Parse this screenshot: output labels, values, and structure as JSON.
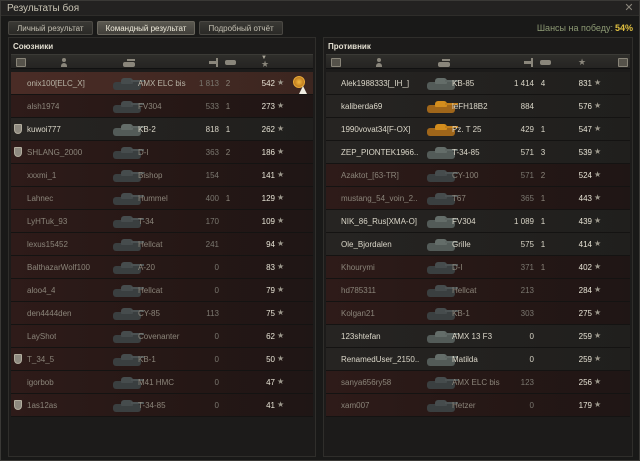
{
  "window": {
    "title": "Результаты боя",
    "close_icon": "close-icon"
  },
  "tabs": [
    {
      "label": "Личный результат",
      "active": false
    },
    {
      "label": "Командный результат",
      "active": true
    },
    {
      "label": "Подробный отчёт",
      "active": false
    }
  ],
  "win_chance": {
    "label": "Шансы на победу:",
    "value": "54%"
  },
  "colors": {
    "accent": "#e0c040",
    "alive_text": "#dcd8ca",
    "dead_text": "#8b857a",
    "dead_row": "#2e1b19",
    "premium_tank": "#d38d1d"
  },
  "allies": {
    "title": "Союзники",
    "columns": [
      "platoon-icon",
      "player-icon",
      "vehicle-icon",
      "damage-icon",
      "kills-icon",
      "experience-star-icon"
    ],
    "rows": [
      {
        "player": "onix100[ELC_X]",
        "vehicle": "AMX ELC bis",
        "damage": "1 813",
        "kills": "2",
        "xp": "542",
        "alive": false,
        "platoon": false,
        "highlight": true,
        "medal": true,
        "tank": "dark"
      },
      {
        "player": "alsh1974",
        "vehicle": "FV304",
        "damage": "533",
        "kills": "1",
        "xp": "273",
        "alive": false,
        "platoon": false,
        "highlight": false,
        "medal": false,
        "tank": "dark"
      },
      {
        "player": "kuwoi777",
        "vehicle": "KB-2",
        "damage": "818",
        "kills": "1",
        "xp": "262",
        "alive": true,
        "platoon": true,
        "highlight": false,
        "medal": false,
        "tank": "live"
      },
      {
        "player": "SHLANG_2000",
        "vehicle": "D-I",
        "damage": "363",
        "kills": "2",
        "xp": "186",
        "alive": false,
        "platoon": true,
        "highlight": false,
        "medal": false,
        "tank": "dark"
      },
      {
        "player": "xxxmi_1",
        "vehicle": "Bishop",
        "damage": "154",
        "kills": "",
        "xp": "141",
        "alive": false,
        "platoon": false,
        "highlight": false,
        "medal": false,
        "tank": "dark"
      },
      {
        "player": "Lahnec",
        "vehicle": "Hummel",
        "damage": "400",
        "kills": "1",
        "xp": "129",
        "alive": false,
        "platoon": false,
        "highlight": false,
        "medal": false,
        "tank": "dark"
      },
      {
        "player": "LyHTuk_93",
        "vehicle": "T-34",
        "damage": "170",
        "kills": "",
        "xp": "109",
        "alive": false,
        "platoon": false,
        "highlight": false,
        "medal": false,
        "tank": "dark"
      },
      {
        "player": "lexus15452",
        "vehicle": "Hellcat",
        "damage": "241",
        "kills": "",
        "xp": "94",
        "alive": false,
        "platoon": false,
        "highlight": false,
        "medal": false,
        "tank": "dark"
      },
      {
        "player": "BalthazarWolf100",
        "vehicle": "A-20",
        "damage": "0",
        "kills": "",
        "xp": "83",
        "alive": false,
        "platoon": false,
        "highlight": false,
        "medal": false,
        "tank": "dark"
      },
      {
        "player": "aloo4_4",
        "vehicle": "Hellcat",
        "damage": "0",
        "kills": "",
        "xp": "79",
        "alive": false,
        "platoon": false,
        "highlight": false,
        "medal": false,
        "tank": "dark"
      },
      {
        "player": "den4444den",
        "vehicle": "CY-85",
        "damage": "113",
        "kills": "",
        "xp": "75",
        "alive": false,
        "platoon": false,
        "highlight": false,
        "medal": false,
        "tank": "dark"
      },
      {
        "player": "LayShot",
        "vehicle": "Covenanter",
        "damage": "0",
        "kills": "",
        "xp": "62",
        "alive": false,
        "platoon": false,
        "highlight": false,
        "medal": false,
        "tank": "dark"
      },
      {
        "player": "T_34_5",
        "vehicle": "KB-1",
        "damage": "0",
        "kills": "",
        "xp": "50",
        "alive": false,
        "platoon": true,
        "highlight": false,
        "medal": false,
        "tank": "dark"
      },
      {
        "player": "igorbob",
        "vehicle": "M41 HMC",
        "damage": "0",
        "kills": "",
        "xp": "47",
        "alive": false,
        "platoon": false,
        "highlight": false,
        "medal": false,
        "tank": "dark"
      },
      {
        "player": "1as12as",
        "vehicle": "T-34-85",
        "damage": "0",
        "kills": "",
        "xp": "41",
        "alive": false,
        "platoon": true,
        "highlight": false,
        "medal": false,
        "tank": "dark"
      }
    ]
  },
  "enemies": {
    "title": "Противник",
    "rows": [
      {
        "player": "Alek1988333[_IH_]",
        "vehicle": "KB-85",
        "damage": "1 414",
        "kills": "4",
        "xp": "831",
        "alive": true,
        "platoon": false,
        "tank": "live"
      },
      {
        "player": "kaliberda69",
        "vehicle": "leFH18B2",
        "damage": "884",
        "kills": "",
        "xp": "576",
        "alive": true,
        "platoon": false,
        "tank": "gold"
      },
      {
        "player": "1990vovat34[F-OX]",
        "vehicle": "Pz. T 25",
        "damage": "429",
        "kills": "1",
        "xp": "547",
        "alive": true,
        "platoon": false,
        "tank": "gold"
      },
      {
        "player": "ZEP_PIONTEK1966..",
        "vehicle": "T-34-85",
        "damage": "571",
        "kills": "3",
        "xp": "539",
        "alive": true,
        "platoon": false,
        "tank": "live"
      },
      {
        "player": "Azaktot_[63-TR]",
        "vehicle": "CY-100",
        "damage": "571",
        "kills": "2",
        "xp": "524",
        "alive": false,
        "platoon": false,
        "tank": "dark"
      },
      {
        "player": "mustang_54_voin_2..",
        "vehicle": "T67",
        "damage": "365",
        "kills": "1",
        "xp": "443",
        "alive": false,
        "platoon": false,
        "tank": "dark"
      },
      {
        "player": "NIK_86_Rus[XMA-O]",
        "vehicle": "FV304",
        "damage": "1 089",
        "kills": "1",
        "xp": "439",
        "alive": true,
        "platoon": false,
        "tank": "live"
      },
      {
        "player": "Ole_Bjordalen",
        "vehicle": "Grille",
        "damage": "575",
        "kills": "1",
        "xp": "414",
        "alive": true,
        "platoon": false,
        "tank": "live"
      },
      {
        "player": "Khourymi",
        "vehicle": "D-I",
        "damage": "371",
        "kills": "1",
        "xp": "402",
        "alive": false,
        "platoon": false,
        "tank": "dark"
      },
      {
        "player": "hd785311",
        "vehicle": "Hellcat",
        "damage": "213",
        "kills": "",
        "xp": "284",
        "alive": false,
        "platoon": false,
        "tank": "dark"
      },
      {
        "player": "Kolgan21",
        "vehicle": "KB-1",
        "damage": "303",
        "kills": "",
        "xp": "275",
        "alive": false,
        "platoon": false,
        "tank": "dark"
      },
      {
        "player": "123shtefan",
        "vehicle": "AMX 13 F3",
        "damage": "0",
        "kills": "",
        "xp": "259",
        "alive": true,
        "platoon": false,
        "tank": "live"
      },
      {
        "player": "RenamedUser_2150..",
        "vehicle": "Matilda",
        "damage": "0",
        "kills": "",
        "xp": "259",
        "alive": true,
        "platoon": false,
        "tank": "live"
      },
      {
        "player": "sanya656ry58",
        "vehicle": "AMX ELC bis",
        "damage": "123",
        "kills": "",
        "xp": "256",
        "alive": false,
        "platoon": false,
        "tank": "dark"
      },
      {
        "player": "xam007",
        "vehicle": "Hetzer",
        "damage": "0",
        "kills": "",
        "xp": "179",
        "alive": false,
        "platoon": false,
        "tank": "dark"
      }
    ]
  }
}
